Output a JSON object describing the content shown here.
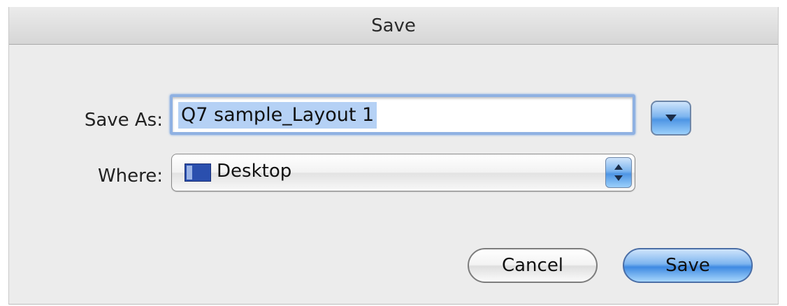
{
  "dialog": {
    "title": "Save"
  },
  "save_as": {
    "label": "Save As:",
    "value": "Q7 sample_Layout 1"
  },
  "where": {
    "label": "Where:",
    "selected": "Desktop",
    "icon": "desktop-folder-icon"
  },
  "buttons": {
    "cancel_label": "Cancel",
    "save_label": "Save"
  },
  "colors": {
    "window_bg": "#ececec",
    "selection": "#b5d1f5",
    "aqua_blue": "#4e95e4"
  }
}
